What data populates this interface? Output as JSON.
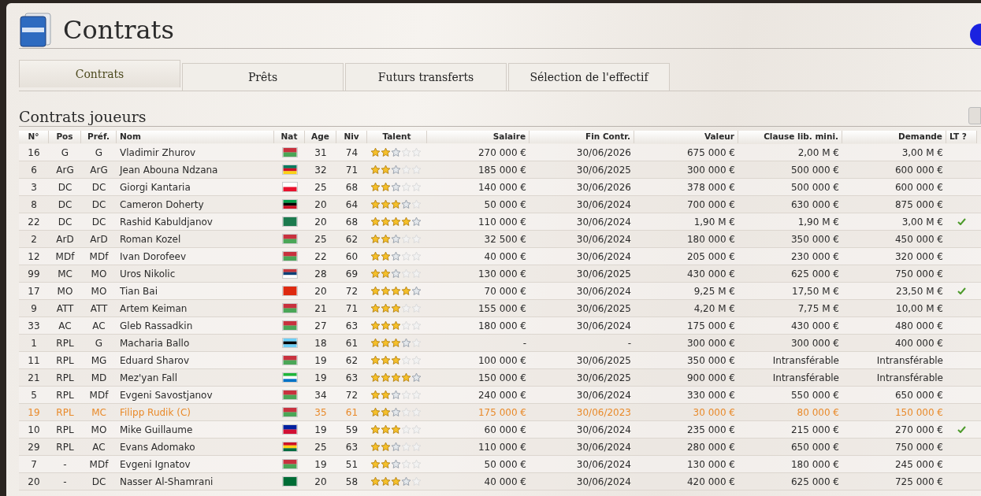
{
  "page": {
    "title": "Contrats"
  },
  "tabs": [
    {
      "label": "Contrats",
      "selected": true
    },
    {
      "label": "Prêts",
      "selected": false
    },
    {
      "label": "Futurs transferts",
      "selected": false
    },
    {
      "label": "Sélection de l'effectif",
      "selected": false
    }
  ],
  "section": {
    "title": "Contrats joueurs"
  },
  "table": {
    "columns": [
      "N°",
      "Pos",
      "Préf.",
      "Nom",
      "Nat",
      "Age",
      "Niv",
      "Talent",
      "Salaire",
      "Fin Contr.",
      "Valeur",
      "Clause lib. mini.",
      "Demande",
      "LT ?"
    ],
    "rows": [
      {
        "no": "16",
        "pos": "G",
        "pref": "G",
        "name": "Vladimir Zhurov",
        "flag": [
          {
            "color": "#c8313e"
          },
          {
            "color": "#4aa657"
          }
        ],
        "age": "31",
        "niv": "74",
        "stars": 2,
        "grey_star": true,
        "salary": "270 000 €",
        "end": "30/06/2026",
        "value": "675 000 €",
        "clause": "2,00 M €",
        "demand": "3,00 M €",
        "lt": false,
        "highlighted": false
      },
      {
        "no": "6",
        "pos": "ArG",
        "pref": "ArG",
        "name": "Jean Abouna Ndzana",
        "flag": [
          {
            "color": "#007a5e"
          },
          {
            "color": "#ce1126"
          },
          {
            "color": "#fcd116"
          }
        ],
        "age": "32",
        "niv": "71",
        "stars": 2,
        "grey_star": true,
        "salary": "185 000 €",
        "end": "30/06/2025",
        "value": "300 000 €",
        "clause": "500 000 €",
        "demand": "600 000 €",
        "lt": false,
        "highlighted": false
      },
      {
        "no": "3",
        "pos": "DC",
        "pref": "DC",
        "name": "Giorgi Kantaria",
        "flag": [
          {
            "color": "#ffffff"
          },
          {
            "color": "#e8112d"
          }
        ],
        "age": "25",
        "niv": "68",
        "stars": 2,
        "grey_star": true,
        "salary": "140 000 €",
        "end": "30/06/2026",
        "value": "378 000 €",
        "clause": "500 000 €",
        "demand": "600 000 €",
        "lt": false,
        "highlighted": false
      },
      {
        "no": "8",
        "pos": "DC",
        "pref": "DC",
        "name": "Cameron Doherty",
        "flag": [
          {
            "color": "#009e49"
          },
          {
            "color": "#000000"
          },
          {
            "color": "#ce1126"
          }
        ],
        "age": "20",
        "niv": "64",
        "stars": 3,
        "grey_star": true,
        "salary": "50 000 €",
        "end": "30/06/2024",
        "value": "700 000 €",
        "clause": "630 000 €",
        "demand": "875 000 €",
        "lt": false,
        "highlighted": false
      },
      {
        "no": "22",
        "pos": "DC",
        "pref": "DC",
        "name": "Rashid Kabuldjanov",
        "flag": [
          {
            "color": "#1c7a4e"
          }
        ],
        "age": "20",
        "niv": "68",
        "stars": 4,
        "grey_star": true,
        "salary": "110 000 €",
        "end": "30/06/2024",
        "value": "1,90 M €",
        "clause": "1,90 M €",
        "demand": "3,00 M €",
        "lt": true,
        "highlighted": false
      },
      {
        "no": "2",
        "pos": "ArD",
        "pref": "ArD",
        "name": "Roman Kozel",
        "flag": [
          {
            "color": "#c8313e"
          },
          {
            "color": "#4aa657"
          }
        ],
        "age": "25",
        "niv": "62",
        "stars": 2,
        "grey_star": true,
        "salary": "32 500 €",
        "end": "30/06/2024",
        "value": "180 000 €",
        "clause": "350 000 €",
        "demand": "450 000 €",
        "lt": false,
        "highlighted": false
      },
      {
        "no": "12",
        "pos": "MDf",
        "pref": "MDf",
        "name": "Ivan Dorofeev",
        "flag": [
          {
            "color": "#c8313e"
          },
          {
            "color": "#4aa657"
          }
        ],
        "age": "22",
        "niv": "60",
        "stars": 2,
        "grey_star": true,
        "salary": "40 000 €",
        "end": "30/06/2024",
        "value": "205 000 €",
        "clause": "230 000 €",
        "demand": "320 000 €",
        "lt": false,
        "highlighted": false
      },
      {
        "no": "99",
        "pos": "MC",
        "pref": "MO",
        "name": "Uros Nikolic",
        "flag": [
          {
            "color": "#c6363c"
          },
          {
            "color": "#0c4076"
          },
          {
            "color": "#ffffff"
          }
        ],
        "age": "28",
        "niv": "69",
        "stars": 2,
        "grey_star": true,
        "salary": "130 000 €",
        "end": "30/06/2025",
        "value": "430 000 €",
        "clause": "625 000 €",
        "demand": "750 000 €",
        "lt": false,
        "highlighted": false
      },
      {
        "no": "17",
        "pos": "MO",
        "pref": "MO",
        "name": "Tian Bai",
        "flag": [
          {
            "color": "#de2910"
          }
        ],
        "age": "20",
        "niv": "72",
        "stars": 4,
        "grey_star": true,
        "salary": "70 000 €",
        "end": "30/06/2024",
        "value": "9,25 M €",
        "clause": "17,50 M €",
        "demand": "23,50 M €",
        "lt": true,
        "highlighted": false
      },
      {
        "no": "9",
        "pos": "ATT",
        "pref": "ATT",
        "name": "Artem Keiman",
        "flag": [
          {
            "color": "#c8313e"
          },
          {
            "color": "#4aa657"
          }
        ],
        "age": "21",
        "niv": "71",
        "stars": 3,
        "grey_star": false,
        "salary": "155 000 €",
        "end": "30/06/2025",
        "value": "4,20 M €",
        "clause": "7,75 M €",
        "demand": "10,00 M €",
        "lt": false,
        "highlighted": false
      },
      {
        "no": "33",
        "pos": "AC",
        "pref": "AC",
        "name": "Gleb Rassadkin",
        "flag": [
          {
            "color": "#c8313e"
          },
          {
            "color": "#4aa657"
          }
        ],
        "age": "27",
        "niv": "63",
        "stars": 3,
        "grey_star": false,
        "salary": "180 000 €",
        "end": "30/06/2024",
        "value": "175 000 €",
        "clause": "430 000 €",
        "demand": "480 000 €",
        "lt": false,
        "highlighted": false
      },
      {
        "no": "1",
        "pos": "RPL",
        "pref": "G",
        "name": "Macharia Ballo",
        "flag": [
          {
            "color": "#6dcff6"
          },
          {
            "color": "#000000"
          },
          {
            "color": "#6dcff6"
          }
        ],
        "age": "18",
        "niv": "61",
        "stars": 3,
        "grey_star": true,
        "salary": "-",
        "end": "-",
        "value": "300 000 €",
        "clause": "300 000 €",
        "demand": "400 000 €",
        "lt": false,
        "highlighted": false
      },
      {
        "no": "11",
        "pos": "RPL",
        "pref": "MG",
        "name": "Eduard Sharov",
        "flag": [
          {
            "color": "#c8313e"
          },
          {
            "color": "#4aa657"
          }
        ],
        "age": "19",
        "niv": "62",
        "stars": 3,
        "grey_star": false,
        "salary": "100 000 €",
        "end": "30/06/2025",
        "value": "350 000 €",
        "clause": "Intransférable",
        "demand": "Intransférable",
        "lt": false,
        "highlighted": false
      },
      {
        "no": "21",
        "pos": "RPL",
        "pref": "MD",
        "name": "Mez'yan Fall",
        "flag": [
          {
            "color": "#1eb53a"
          },
          {
            "color": "#ffffff"
          },
          {
            "color": "#0072c6"
          }
        ],
        "age": "19",
        "niv": "63",
        "stars": 4,
        "grey_star": true,
        "salary": "150 000 €",
        "end": "30/06/2025",
        "value": "900 000 €",
        "clause": "Intransférable",
        "demand": "Intransférable",
        "lt": false,
        "highlighted": false
      },
      {
        "no": "5",
        "pos": "RPL",
        "pref": "MDf",
        "name": "Evgeni Savostjanov",
        "flag": [
          {
            "color": "#c8313e"
          },
          {
            "color": "#4aa657"
          }
        ],
        "age": "34",
        "niv": "72",
        "stars": 2,
        "grey_star": true,
        "salary": "240 000 €",
        "end": "30/06/2024",
        "value": "330 000 €",
        "clause": "550 000 €",
        "demand": "650 000 €",
        "lt": false,
        "highlighted": false
      },
      {
        "no": "19",
        "pos": "RPL",
        "pref": "MC",
        "name": "Filipp Rudik (C)",
        "flag": [
          {
            "color": "#c8313e"
          },
          {
            "color": "#4aa657"
          }
        ],
        "age": "35",
        "niv": "61",
        "stars": 2,
        "grey_star": true,
        "salary": "175 000 €",
        "end": "30/06/2023",
        "value": "30 000 €",
        "clause": "80 000 €",
        "demand": "150 000 €",
        "lt": false,
        "highlighted": true
      },
      {
        "no": "10",
        "pos": "RPL",
        "pref": "MO",
        "name": "Mike Guillaume",
        "flag": [
          {
            "color": "#00209f"
          },
          {
            "color": "#d21034"
          }
        ],
        "age": "19",
        "niv": "59",
        "stars": 3,
        "grey_star": false,
        "salary": "60 000 €",
        "end": "30/06/2024",
        "value": "235 000 €",
        "clause": "215 000 €",
        "demand": "270 000 €",
        "lt": true,
        "highlighted": false
      },
      {
        "no": "29",
        "pos": "RPL",
        "pref": "AC",
        "name": "Evans Adomako",
        "flag": [
          {
            "color": "#ce1126"
          },
          {
            "color": "#fcd116"
          },
          {
            "color": "#006b3f"
          }
        ],
        "age": "25",
        "niv": "63",
        "stars": 2,
        "grey_star": true,
        "salary": "110 000 €",
        "end": "30/06/2024",
        "value": "280 000 €",
        "clause": "650 000 €",
        "demand": "750 000 €",
        "lt": false,
        "highlighted": false
      },
      {
        "no": "7",
        "pos": "-",
        "pref": "MDf",
        "name": "Evgeni Ignatov",
        "flag": [
          {
            "color": "#c8313e"
          },
          {
            "color": "#4aa657"
          }
        ],
        "age": "19",
        "niv": "51",
        "stars": 2,
        "grey_star": true,
        "salary": "50 000 €",
        "end": "30/06/2024",
        "value": "130 000 €",
        "clause": "180 000 €",
        "demand": "245 000 €",
        "lt": false,
        "highlighted": false
      },
      {
        "no": "20",
        "pos": "-",
        "pref": "DC",
        "name": "Nasser Al-Shamrani",
        "flag": [
          {
            "color": "#006c35"
          }
        ],
        "age": "20",
        "niv": "58",
        "stars": 3,
        "grey_star": true,
        "salary": "40 000 €",
        "end": "30/06/2024",
        "value": "420 000 €",
        "clause": "625 000 €",
        "demand": "725 000 €",
        "lt": false,
        "highlighted": false
      }
    ]
  }
}
